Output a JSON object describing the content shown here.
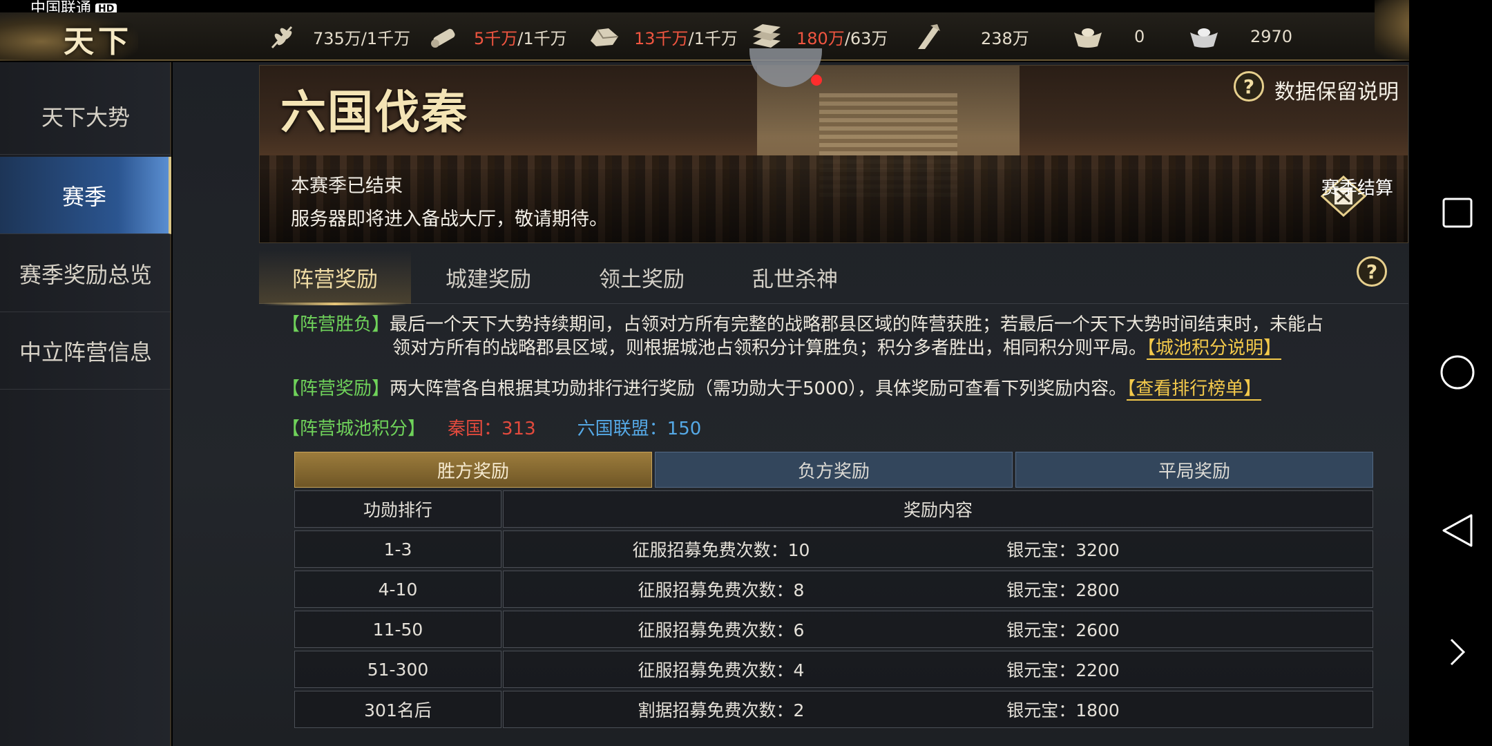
{
  "status": {
    "carrier": "中国联通",
    "badge": "HD"
  },
  "logo": {
    "text": "天下"
  },
  "resources": [
    {
      "icon": "wheat-icon",
      "value": "735万/1千万",
      "highlight": ""
    },
    {
      "icon": "wood-icon",
      "value": "/1千万",
      "highlight": "5千万"
    },
    {
      "icon": "stone-icon",
      "value": "/1千万",
      "highlight": "13千万"
    },
    {
      "icon": "iron-icon",
      "value": "/63万",
      "highlight": "180万"
    },
    {
      "icon": "copper-icon",
      "value": "238万",
      "highlight": ""
    },
    {
      "icon": "gold-ingot-icon",
      "value": "0",
      "highlight": ""
    },
    {
      "icon": "silver-ingot-icon",
      "value": "2970",
      "highlight": ""
    }
  ],
  "sidebar": {
    "items": [
      {
        "label": "天下大势"
      },
      {
        "label": "赛季"
      },
      {
        "label": "赛季奖励总览"
      },
      {
        "label": "中立阵营信息"
      }
    ]
  },
  "banner": {
    "title": "六国伐秦",
    "line1": "本赛季已结束",
    "line2": "服务器即将进入备战大厅，敬请期待。",
    "data_note": "数据保留说明",
    "settle_label": "赛季结算"
  },
  "tabs": [
    {
      "label": "阵营奖励"
    },
    {
      "label": "城建奖励"
    },
    {
      "label": "领土奖励"
    },
    {
      "label": "乱世杀神"
    }
  ],
  "info": {
    "win_tag": "【阵营胜负】",
    "win_text1": "最后一个天下大势持续期间，占领对方所有完整的战略郡县区域的阵营获胜；若最后一个天下大势时间结束时，未能占",
    "win_text2": "领对方所有的战略郡县区域，则根据城池占领积分计算胜负；积分多者胜出，相同积分则平局。",
    "win_link": "【城池积分说明】",
    "reward_tag": "【阵营奖励】",
    "reward_text": "两大阵营各自根据其功勋排行进行奖励（需功勋大于5000），具体奖励可查看下列奖励内容。",
    "reward_link": "【查看排行榜单】",
    "score_tag": "【阵营城池积分】",
    "qin_score": "秦国：313",
    "six_score": "六国联盟：150"
  },
  "reward_tabs": [
    {
      "label": "胜方奖励"
    },
    {
      "label": "负方奖励"
    },
    {
      "label": "平局奖励"
    }
  ],
  "table": {
    "headers": [
      "功勋排行",
      "奖励内容"
    ],
    "rows": [
      {
        "rank": "1-3",
        "recruit": "征服招募免费次数：10",
        "silver": "银元宝：3200"
      },
      {
        "rank": "4-10",
        "recruit": "征服招募免费次数：8",
        "silver": "银元宝：2800"
      },
      {
        "rank": "11-50",
        "recruit": "征服招募免费次数：6",
        "silver": "银元宝：2600"
      },
      {
        "rank": "51-300",
        "recruit": "征服招募免费次数：4",
        "silver": "银元宝：2200"
      },
      {
        "rank": "301名后",
        "recruit": "割据招募免费次数：2",
        "silver": "银元宝：1800"
      }
    ]
  }
}
